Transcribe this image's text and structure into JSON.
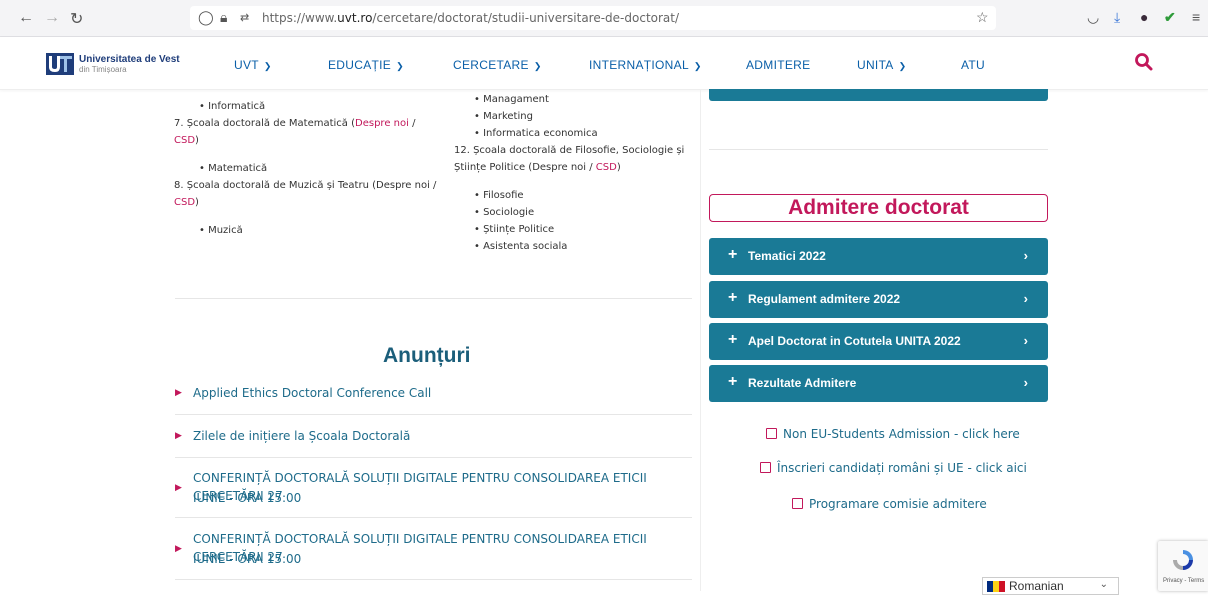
{
  "browser": {
    "url_prefix": "https://www.",
    "url_domain": "uvt.ro",
    "url_path": "/cercetare/doctorat/studii-universitare-de-doctorat/"
  },
  "header": {
    "logo_title": "Universitatea de Vest",
    "logo_subtitle": "din Timișoara",
    "menu": [
      {
        "label": "UVT",
        "dropdown": true
      },
      {
        "label": "EDUCAȚIE",
        "dropdown": true
      },
      {
        "label": "CERCETARE",
        "dropdown": true
      },
      {
        "label": "INTERNAȚIONAL",
        "dropdown": true
      },
      {
        "label": "ADMITERE",
        "dropdown": false
      },
      {
        "label": "UNITA",
        "dropdown": true
      },
      {
        "label": "ATU",
        "dropdown": false
      }
    ]
  },
  "schools_left": {
    "informatica": "Informatică",
    "school7": "7. Școala doctorală de Matematică (",
    "despre": "Despre noi",
    "slash": " /",
    "csd": "CSD",
    "close": ")",
    "matematica": "Matematică",
    "school8_line1": "8. Școala doctorală de Muzică și Teatru (Despre noi /",
    "muzica": "Muzică"
  },
  "schools_right": {
    "items_top": [
      "Managament",
      "Marketing",
      "Informatica economica"
    ],
    "school12_line1": "12. Școala doctorală de Filosofie, Sociologie și",
    "school12_line2": "Științe Politice (Despre noi / ",
    "csd": "CSD",
    "close": ")",
    "items_bottom": [
      "Filosofie",
      "Sociologie",
      "Științe Politice",
      "Asistenta sociala"
    ]
  },
  "announcements": {
    "title": "Anunțuri",
    "items": [
      {
        "lines": [
          "Applied Ethics Doctoral Conference Call"
        ]
      },
      {
        "lines": [
          "Zilele de inițiere la Școala Doctorală"
        ]
      },
      {
        "lines": [
          "CONFERINȚĂ DOCTORALĂ SOLUȚII DIGITALE PENTRU CONSOLIDAREA ETICII CERCETĂRII 27",
          "IUNIE - ORA 15:00"
        ]
      },
      {
        "lines": [
          "CONFERINȚĂ DOCTORALĂ SOLUȚII DIGITALE PENTRU CONSOLIDAREA ETICII CERCETĂRII 27",
          "IUNIE - ORA 15:00"
        ]
      }
    ]
  },
  "sidebar": {
    "admitere_title": "Admitere doctorat",
    "accordion": [
      "Tematici 2022",
      "Regulament admitere 2022",
      "Apel Doctorat in Cotutela UNITA 2022",
      "Rezultate Admitere"
    ],
    "links": [
      "Non EU-Students Admission - click here",
      "Înscrieri candidați români și UE - click aici",
      "Programare comisie admitere"
    ]
  },
  "language": {
    "selected": "Romanian"
  },
  "recaptcha": {
    "text": "Privacy - Terms"
  },
  "colors": {
    "teal": "#1a7a96",
    "accent_red": "#c2185b",
    "nav_blue": "#0a5fa8"
  }
}
